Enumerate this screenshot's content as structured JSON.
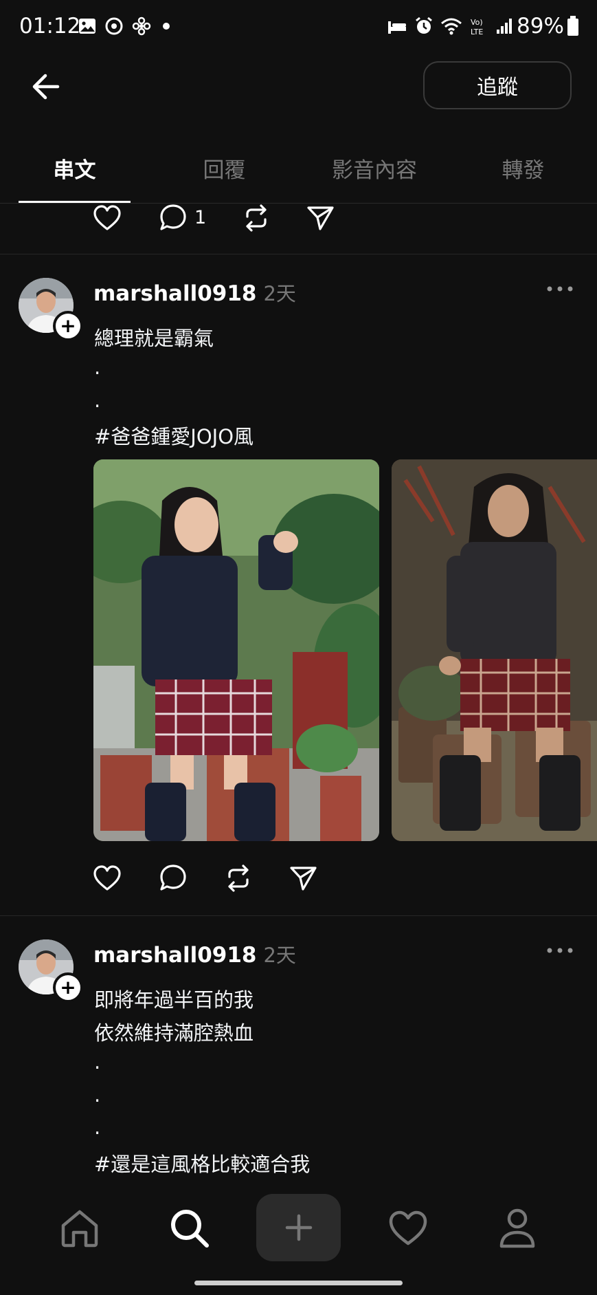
{
  "status_bar": {
    "time": "01:12",
    "battery": "89%",
    "left_icons": [
      "gallery-icon",
      "sync-icon",
      "fan-icon",
      "dot-icon"
    ],
    "right_icons": [
      "sleep-icon",
      "alarm-icon",
      "wifi-icon",
      "volte-icon",
      "signal-icon",
      "battery-icon"
    ]
  },
  "header": {
    "follow_label": "追蹤"
  },
  "tabs": [
    {
      "label": "串文",
      "active": true
    },
    {
      "label": "回覆",
      "active": false
    },
    {
      "label": "影音內容",
      "active": false
    },
    {
      "label": "轉發",
      "active": false
    }
  ],
  "top_actions": {
    "reply_count": "1"
  },
  "posts": [
    {
      "username": "marshall0918",
      "time": "2天",
      "lines": [
        "總理就是霸氣",
        ".",
        ".",
        "#爸爸鍾愛JOJO風"
      ]
    },
    {
      "username": "marshall0918",
      "time": "2天",
      "lines": [
        "即將年過半百的我",
        "依然維持滿腔熱血",
        ".",
        ".",
        ".",
        "#還是這風格比較適合我"
      ]
    }
  ],
  "colors": {
    "background": "#101010",
    "text": "#f3f5f7",
    "muted": "#777777",
    "compose_bg": "#2b2b2b"
  }
}
